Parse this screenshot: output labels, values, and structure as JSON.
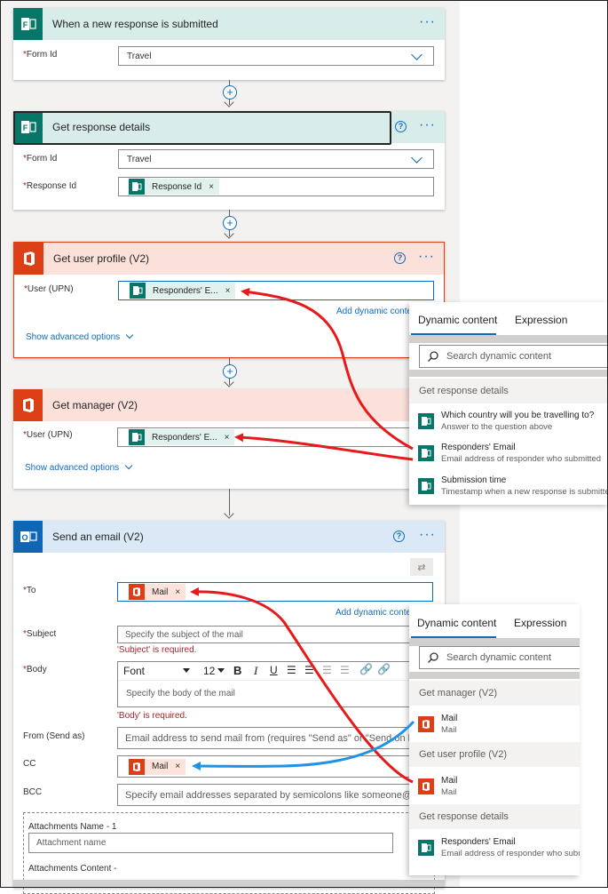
{
  "colors": {
    "teal": "#077568",
    "office_red": "#dc3e15",
    "outlook_blue": "#0f66b5",
    "accent": "#0f6cbd",
    "error": "#a4262c",
    "arrow_red": "#e8191b",
    "arrow_blue": "#1f93e6"
  },
  "trigger": {
    "title": "When a new response is submitted",
    "form_id_label": "Form Id",
    "form_id_value": "Travel"
  },
  "get_response": {
    "title": "Get response details",
    "form_id_label": "Form Id",
    "form_id_value": "Travel",
    "response_id_label": "Response Id",
    "response_id_token": "Response Id"
  },
  "get_user": {
    "title": "Get user profile (V2)",
    "user_label": "User (UPN)",
    "token": "Responders' E...",
    "add_dynamic": "Add dynamic content",
    "advanced": "Show advanced options"
  },
  "get_manager": {
    "title": "Get manager (V2)",
    "user_label": "User (UPN)",
    "token": "Responders' E...",
    "advanced": "Show advanced options"
  },
  "send_email": {
    "title": "Send an email (V2)",
    "to_label": "To",
    "to_token": "Mail",
    "add_dynamic": "Add dynamic content",
    "subject_label": "Subject",
    "subject_placeholder": "Specify the subject of the mail",
    "subject_error": "'Subject' is required.",
    "body_label": "Body",
    "font": "Font",
    "font_size": "12",
    "body_placeholder": "Specify the body of the mail",
    "body_error": "'Body' is required.",
    "from_label": "From (Send as)",
    "from_placeholder": "Email address to send mail from (requires \"Send as\" or \"Send on behalf of\" permission)",
    "cc_label": "CC",
    "cc_token": "Mail",
    "bcc_label": "BCC",
    "bcc_placeholder": "Specify email addresses separated by semicolons like someone@contoso.com",
    "attach_name_label": "Attachments Name - 1",
    "attach_name_placeholder": "Attachment name",
    "attach_content_label": "Attachments Content -"
  },
  "panel1": {
    "tab_dynamic": "Dynamic content",
    "tab_expression": "Expression",
    "search_placeholder": "Search dynamic content",
    "section": "Get response details",
    "items": [
      {
        "title": "Which country will you be travelling to?",
        "desc": "Answer to the question above"
      },
      {
        "title": "Responders' Email",
        "desc": "Email address of responder who submitted"
      },
      {
        "title": "Submission time",
        "desc": "Timestamp when a new response is submitted"
      }
    ]
  },
  "panel2": {
    "tab_dynamic": "Dynamic content",
    "tab_expression": "Expression",
    "search_placeholder": "Search dynamic content",
    "section_manager": "Get manager (V2)",
    "manager_item": {
      "title": "Mail",
      "desc": "Mail"
    },
    "section_user": "Get user profile (V2)",
    "user_item": {
      "title": "Mail",
      "desc": "Mail"
    },
    "section_response": "Get response details",
    "response_item": {
      "title": "Responders' Email",
      "desc": "Email address of responder who submitted"
    }
  },
  "required_mark": "*",
  "close_glyph": "×"
}
